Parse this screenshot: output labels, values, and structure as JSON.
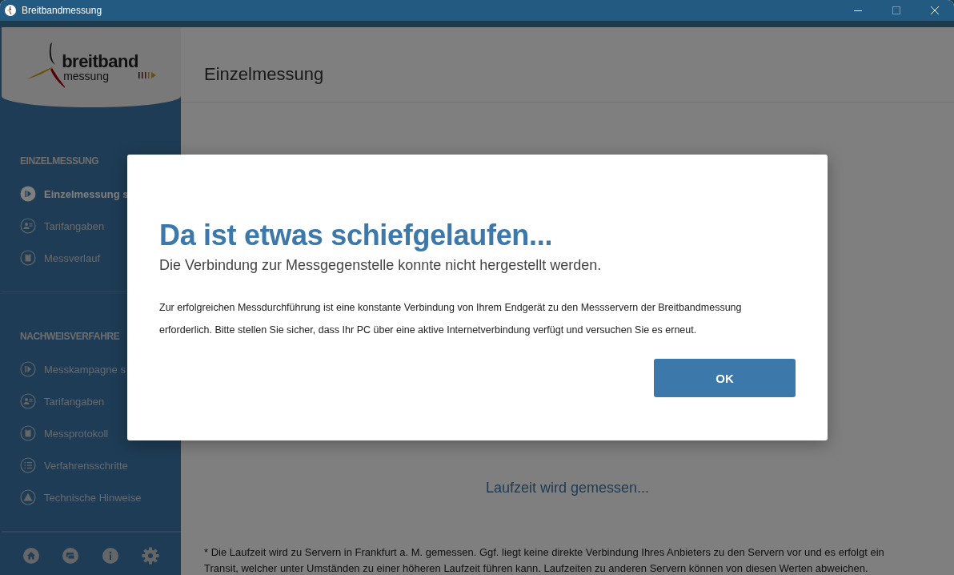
{
  "window": {
    "title": "Breitbandmessung"
  },
  "sidebar": {
    "logo": {
      "line1": "breitband",
      "line2": "messung"
    },
    "sections": [
      {
        "heading": "EINZELMESSUNG",
        "items": [
          {
            "label": "Einzelmessung s",
            "kind": "play",
            "selected": true
          },
          {
            "label": "Tarifangaben",
            "kind": "tariff",
            "selected": false
          },
          {
            "label": "Messverlauf",
            "kind": "clipboard",
            "selected": false
          }
        ]
      },
      {
        "heading": "NACHWEISVERFAHRE",
        "items": [
          {
            "label": "Messkampagne s",
            "kind": "play",
            "selected": false
          },
          {
            "label": "Tarifangaben",
            "kind": "tariff",
            "selected": false
          },
          {
            "label": "Messprotokoll",
            "kind": "clipboard",
            "selected": false
          },
          {
            "label": "Verfahrensschritte",
            "kind": "list",
            "selected": false
          },
          {
            "label": "Technische Hinweise",
            "kind": "warning",
            "selected": false
          }
        ]
      }
    ]
  },
  "main": {
    "title": "Einzelmessung",
    "status": "Laufzeit wird gemessen...",
    "footnote": "* Die Laufzeit wird zu Servern in Frankfurt a. M. gemessen. Ggf. liegt keine direkte Verbindung Ihres Anbieters zu den Servern vor und es erfolgt ein Transit, welcher unter Umständen zu einer höheren Laufzeit führen kann. Laufzeiten zu anderen Servern können von diesen Werten abweichen."
  },
  "dialog": {
    "title": "Da ist etwas schiefgelaufen...",
    "subtitle": "Die Verbindung zur Messgegenstelle konnte nicht hergestellt werden.",
    "body": "Zur erfolgreichen Messdurchführung ist eine konstante Verbindung von Ihrem Endgerät zu den Messservern der Breitbandmessung erforderlich. Bitte stellen Sie sicher, dass Ihr PC über eine aktive Internetverbindung verfügt und versuchen Sie es erneut.",
    "button": "OK"
  }
}
